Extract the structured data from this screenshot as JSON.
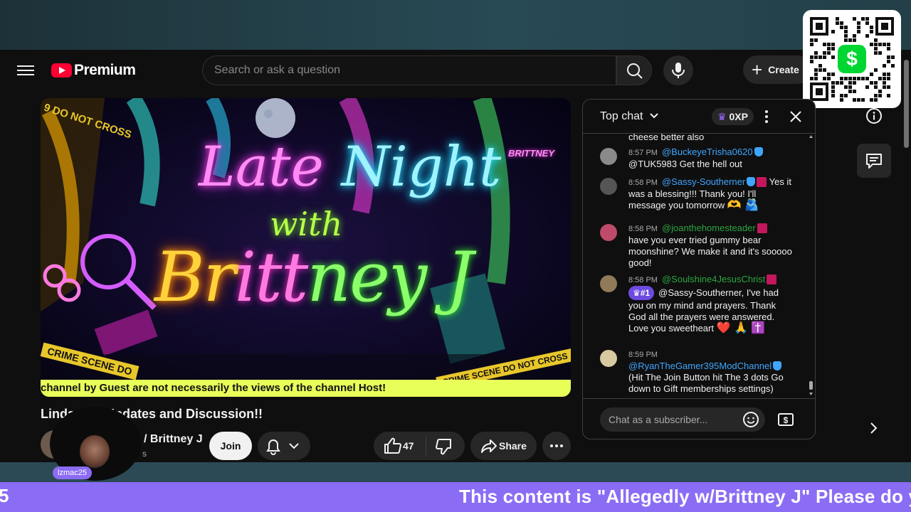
{
  "masthead": {
    "logo_text": "Premium",
    "search_placeholder": "Search or ask a question",
    "create_label": "Create"
  },
  "video": {
    "art": {
      "line1_a": "Late",
      "line1_b": "Night",
      "line2": "with",
      "line3_a": "Br",
      "line3_b": "itt",
      "line3_c": "ney J",
      "brand": "BRITTNEY",
      "tape_1": "9 DO NOT CROSS",
      "tape_2": "CRIME SCENE DO",
      "tape_3": "CRIME SCENE DO NOT CROSS"
    },
    "caption": "channel by Guest are not necessarily the views of the channel Host!",
    "title": "Linda…cy Updates and Discussion!!",
    "channel_name": "/ Brittney J",
    "channel_sub": "s",
    "join_label": "Join",
    "likes": "47",
    "share_label": "Share"
  },
  "overlay": {
    "cam_tag": "lzmac25",
    "ticker_left": "5",
    "ticker_text": "This content is \"Allegedly w/Brittney J\" Please do you"
  },
  "chat": {
    "title": "Top chat",
    "xp": "0XP",
    "input_placeholder": "Chat as a subscriber...",
    "messages": [
      {
        "time": "",
        "author": "",
        "text": "cheese better also"
      },
      {
        "time": "8:57 PM",
        "author": "@BuckeyeTrisha0620",
        "text": "@TUK5983 Get the hell out"
      },
      {
        "time": "8:58 PM",
        "author": "@Sassy-Southerner",
        "text": "Yes it was a blessing!!! Thank you! I'll message you tomorrow",
        "emoji": "🫶 🫂"
      },
      {
        "time": "8:58 PM",
        "author": "@joanthehomesteader",
        "text": "have you ever tried gummy bear moonshine? We make it and it's sooooo good!"
      },
      {
        "time": "8:58 PM",
        "author": "@Soulshine4JesusChrist",
        "rank": "#1",
        "text": "@Sassy-Southerner, I've had you on my mind and prayers. Thank God all the prayers were answered. Love you sweetheart",
        "emoji": "❤️ 🙏 ✝️"
      },
      {
        "time": "8:59 PM",
        "author": "@RyanTheGamer395ModChannel",
        "text": "(Hit The Join Button hit The 3 dots Go down to Gift memberships settings)"
      }
    ]
  },
  "colors": {
    "accent_link": "#3ea6ff",
    "author_green": "#2ba640",
    "ticker_bg": "#8b6cf4",
    "caption_bg": "#e8ff5a",
    "cashapp_green": "#00d632"
  },
  "icons": [
    "menu-icon",
    "youtube-logo-icon",
    "search-icon",
    "mic-icon",
    "plus-icon",
    "chevron-down-icon",
    "crown-icon",
    "more-vert-icon",
    "close-icon",
    "info-icon",
    "chat-icon",
    "chevron-right-icon",
    "bell-icon",
    "thumb-up-icon",
    "thumb-down-icon",
    "share-icon",
    "more-horiz-icon",
    "emoji-icon",
    "super-chat-icon",
    "qr-code-icon"
  ]
}
